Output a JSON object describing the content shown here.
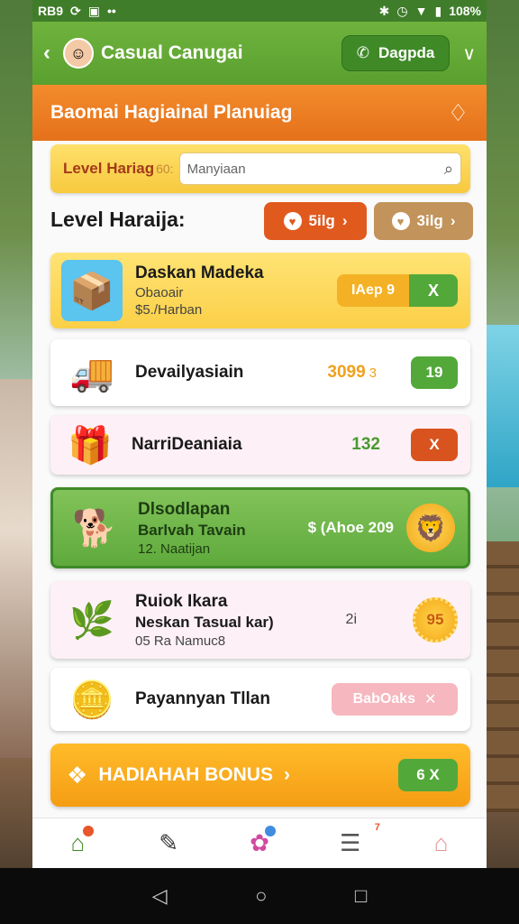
{
  "status": {
    "time": "RB9",
    "battery": "108%"
  },
  "header": {
    "title": "Casual Canugai",
    "call_label": "Dagpda"
  },
  "banner": {
    "title": "Baomai Hagiainal Planuiag"
  },
  "search": {
    "label": "Level Hariag",
    "label_suffix": "60:",
    "placeholder": "Manyiaan"
  },
  "section": {
    "title": "Level Haraija:",
    "pill1": "5ilg",
    "pill2": "3ilg"
  },
  "items": [
    {
      "title": "Daskan Madeka",
      "line2": "Obaoair",
      "line3": "$5./Harban",
      "action_label": "IAep 9",
      "action_x": "X"
    },
    {
      "title": "Devailyasiain",
      "value": "3099",
      "value_suffix": "3",
      "badge": "19"
    },
    {
      "title": "NarriDeaniaia",
      "value": "132",
      "badge": "X"
    },
    {
      "title": "Dlsodlapan",
      "line2": "Barlvah Tavain",
      "line3": "12. Naatijan",
      "mid": "$ (Ahoe 209"
    },
    {
      "title": "Ruiok Ikara",
      "line2": "Neskan Tasual kar)",
      "line3": "05 Ra Namuc8",
      "mid": "2i",
      "badge": "95"
    },
    {
      "title": "Payannyan Tllan",
      "button": "BabOaks"
    }
  ],
  "bonus": {
    "label": "HADIAHAH BONUS",
    "badge": "6 X"
  },
  "bottom_nav": {
    "badge_count": "7"
  },
  "colors": {
    "primary_green": "#5aa02f",
    "banner_orange": "#e5711b",
    "accent_yellow": "#f7c93e",
    "danger": "#d9531e"
  },
  "icons": [
    "home-icon",
    "chat-icon",
    "shop-bag-icon",
    "document-icon",
    "house-icon"
  ]
}
